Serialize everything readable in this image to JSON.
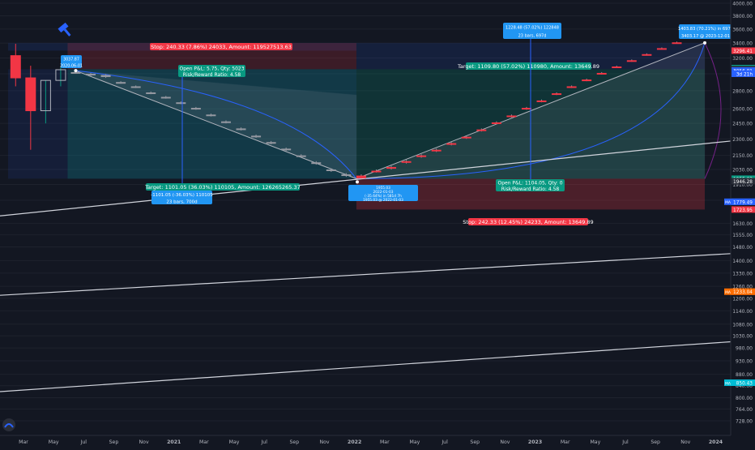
{
  "chart_data": {
    "type": "candlestick",
    "y_axis": {
      "scale": "log",
      "ticks": [
        4000.0,
        3800.0,
        3600.0,
        3400.0,
        3200.0,
        3000.0,
        2800.0,
        2600.0,
        2450.0,
        2300.0,
        2150.0,
        2030.0,
        1910.0,
        1790.0,
        1630.0,
        1555.0,
        1480.0,
        1400.0,
        1330.0,
        1260.0,
        1200.0,
        1140.0,
        1080.0,
        1030.0,
        980.0,
        930.0,
        880.0,
        840.0,
        800.0,
        764.0,
        728.0
      ]
    },
    "x_axis": {
      "ticks": [
        "Mar",
        "May",
        "Jul",
        "Sep",
        "Nov",
        "2021",
        "Mar",
        "May",
        "Jul",
        "Sep",
        "Nov",
        "2022",
        "Mar",
        "May",
        "Jul",
        "Sep",
        "Nov",
        "2023",
        "Mar",
        "May",
        "Jul",
        "Sep",
        "Nov",
        "2024"
      ]
    },
    "price_labels": [
      {
        "text": "3296.41",
        "color": "#f23645"
      },
      {
        "text": "3056.08",
        "color": "#089981"
      },
      {
        "text": "3056.08",
        "color": "#2a2e39"
      },
      {
        "text": "3056.01",
        "color": "#2962ff"
      },
      {
        "text": "3d 21h",
        "color": "#2962ff"
      },
      {
        "text": "1955.03",
        "color": "#089981"
      },
      {
        "text": "1946.28",
        "color": "#2a2e39"
      },
      {
        "text": "1779.49",
        "color": "#2962ff"
      },
      {
        "text": "1723.95",
        "color": "#f23645"
      },
      {
        "text": "1233.04",
        "color": "#ff6d00"
      },
      {
        "text": "850.43",
        "color": "#2962ff"
      }
    ],
    "ma_labels": [
      {
        "text": "MA",
        "value": "1779.49",
        "color": "#2962ff"
      },
      {
        "text": "MA",
        "value": "1233.04",
        "color": "#ff6d00"
      },
      {
        "text": "MA",
        "value": "850.43",
        "color": "#00bcd4"
      }
    ],
    "annotations": {
      "short_stop": "Stop: 240.33 (7.86%) 24033, Amount: 119527513.63",
      "short_pnl_1": "Open P&L: 5.75, Qty: 5023",
      "short_pnl_2": "Risk/Reward Ratio: 4.58",
      "short_target": "Target: 1101.05 (36.03%) 110105, Amount: 126265265.37",
      "long_target": "Target: 1109.80 (57.02%) 110980, Amount: 13649.89",
      "long_pnl_1": "Open P&L: 1104.05, Qty: 0",
      "long_pnl_2": "Risk/Reward Ratio: 4.58",
      "long_stop": "Stop: 242.33 (12.45%) 24233, Amount: 13649.89",
      "top_label_1": "3037.87",
      "top_label_2": "2020-06-01",
      "range_short_1": "-1101.05 (-36.03%) 110105",
      "range_short_2": "23 bars, 700d",
      "low_label_1": "1955.03",
      "low_label_2": "2022-01-03",
      "low_label_3": "(-35.64%) in 581d 7h",
      "low_label_4": "1955.03 @ 2022-01-03",
      "range_long_1": "1228.48 (57.02%) 122848",
      "range_long_2": "23 bars, 697d",
      "end_label_1": "1403.83 (70.21%) in 697d",
      "end_label_2": "3403.17 @ 2023-12-01"
    },
    "candles": [
      {
        "date": "2020-02",
        "open": 3230,
        "high": 3390,
        "low": 2850,
        "close": 2950
      },
      {
        "date": "2020-03",
        "open": 2950,
        "high": 3100,
        "low": 2200,
        "close": 2580
      },
      {
        "date": "2020-04",
        "open": 2580,
        "high": 2920,
        "low": 2450,
        "close": 2920
      },
      {
        "date": "2020-05",
        "open": 2920,
        "high": 3080,
        "low": 2850,
        "close": 3050
      },
      {
        "date": "2020-06",
        "open": 3020,
        "high": 3040,
        "low": 3000,
        "close": 3010
      },
      {
        "date": "2020-07",
        "open": 3000,
        "high": 3010,
        "low": 2970,
        "close": 2985
      },
      {
        "date": "2020-08",
        "open": 2985,
        "high": 2995,
        "low": 2950,
        "close": 2960
      },
      {
        "date": "2020-09",
        "open": 2900,
        "high": 2910,
        "low": 2880,
        "close": 2890
      },
      {
        "date": "2020-10",
        "open": 2850,
        "high": 2860,
        "low": 2830,
        "close": 2840
      },
      {
        "date": "2020-11",
        "open": 2780,
        "high": 2790,
        "low": 2760,
        "close": 2770
      },
      {
        "date": "2020-12",
        "open": 2730,
        "high": 2740,
        "low": 2710,
        "close": 2720
      },
      {
        "date": "2021-01",
        "open": 2670,
        "high": 2680,
        "low": 2650,
        "close": 2660
      },
      {
        "date": "2021-02",
        "open": 2610,
        "high": 2620,
        "low": 2590,
        "close": 2600
      },
      {
        "date": "2021-03",
        "open": 2540,
        "high": 2550,
        "low": 2520,
        "close": 2530
      },
      {
        "date": "2021-04",
        "open": 2470,
        "high": 2480,
        "low": 2450,
        "close": 2460
      },
      {
        "date": "2021-05",
        "open": 2400,
        "high": 2410,
        "low": 2380,
        "close": 2390
      },
      {
        "date": "2021-06",
        "open": 2330,
        "high": 2340,
        "low": 2310,
        "close": 2320
      },
      {
        "date": "2021-07",
        "open": 2270,
        "high": 2280,
        "low": 2250,
        "close": 2260
      },
      {
        "date": "2021-08",
        "open": 2210,
        "high": 2220,
        "low": 2190,
        "close": 2200
      },
      {
        "date": "2021-09",
        "open": 2150,
        "high": 2160,
        "low": 2130,
        "close": 2140
      },
      {
        "date": "2021-10",
        "open": 2090,
        "high": 2100,
        "low": 2070,
        "close": 2080
      },
      {
        "date": "2021-11",
        "open": 2030,
        "high": 2040,
        "low": 2010,
        "close": 2020
      },
      {
        "date": "2021-12",
        "open": 1990,
        "high": 2000,
        "low": 1970,
        "close": 1980
      },
      {
        "date": "2022-01",
        "open": 1958,
        "high": 1990,
        "low": 1955,
        "close": 1980
      },
      {
        "date": "2022-02",
        "open": 2010,
        "high": 2030,
        "low": 2005,
        "close": 2020
      },
      {
        "date": "2022-03",
        "open": 2040,
        "high": 2060,
        "low": 2030,
        "close": 2050
      },
      {
        "date": "2022-04",
        "open": 2090,
        "high": 2110,
        "low": 2080,
        "close": 2100
      },
      {
        "date": "2022-05",
        "open": 2140,
        "high": 2160,
        "low": 2130,
        "close": 2150
      },
      {
        "date": "2022-06",
        "open": 2190,
        "high": 2210,
        "low": 2180,
        "close": 2200
      },
      {
        "date": "2022-07",
        "open": 2250,
        "high": 2270,
        "low": 2240,
        "close": 2260
      },
      {
        "date": "2022-08",
        "open": 2310,
        "high": 2330,
        "low": 2300,
        "close": 2320
      },
      {
        "date": "2022-09",
        "open": 2380,
        "high": 2400,
        "low": 2370,
        "close": 2390
      },
      {
        "date": "2022-10",
        "open": 2450,
        "high": 2470,
        "low": 2440,
        "close": 2460
      },
      {
        "date": "2022-11",
        "open": 2520,
        "high": 2540,
        "low": 2510,
        "close": 2530
      },
      {
        "date": "2022-12",
        "open": 2600,
        "high": 2620,
        "low": 2590,
        "close": 2610
      },
      {
        "date": "2023-01",
        "open": 2680,
        "high": 2700,
        "low": 2670,
        "close": 2690
      },
      {
        "date": "2023-02",
        "open": 2760,
        "high": 2780,
        "low": 2750,
        "close": 2770
      },
      {
        "date": "2023-03",
        "open": 2840,
        "high": 2860,
        "low": 2830,
        "close": 2850
      },
      {
        "date": "2023-04",
        "open": 2920,
        "high": 2940,
        "low": 2910,
        "close": 2930
      },
      {
        "date": "2023-05",
        "open": 3000,
        "high": 3020,
        "low": 2990,
        "close": 3010
      },
      {
        "date": "2023-06",
        "open": 3080,
        "high": 3100,
        "low": 3070,
        "close": 3090
      },
      {
        "date": "2023-07",
        "open": 3160,
        "high": 3180,
        "low": 3150,
        "close": 3170
      },
      {
        "date": "2023-08",
        "open": 3240,
        "high": 3260,
        "low": 3230,
        "close": 3250
      },
      {
        "date": "2023-09",
        "open": 3320,
        "high": 3340,
        "low": 3310,
        "close": 3330
      },
      {
        "date": "2023-10",
        "open": 3400,
        "high": 3420,
        "low": 3390,
        "close": 3410
      }
    ]
  },
  "colors": {
    "background": "#131722",
    "bull": "#089981",
    "bear": "#f23645",
    "accent": "#2962ff",
    "target_fill": "#1b5e20",
    "stop_fill": "#7f1d1d"
  },
  "icons": {
    "tool_icon": "hammer-icon",
    "logo_icon": "tradingview-logo-icon"
  }
}
